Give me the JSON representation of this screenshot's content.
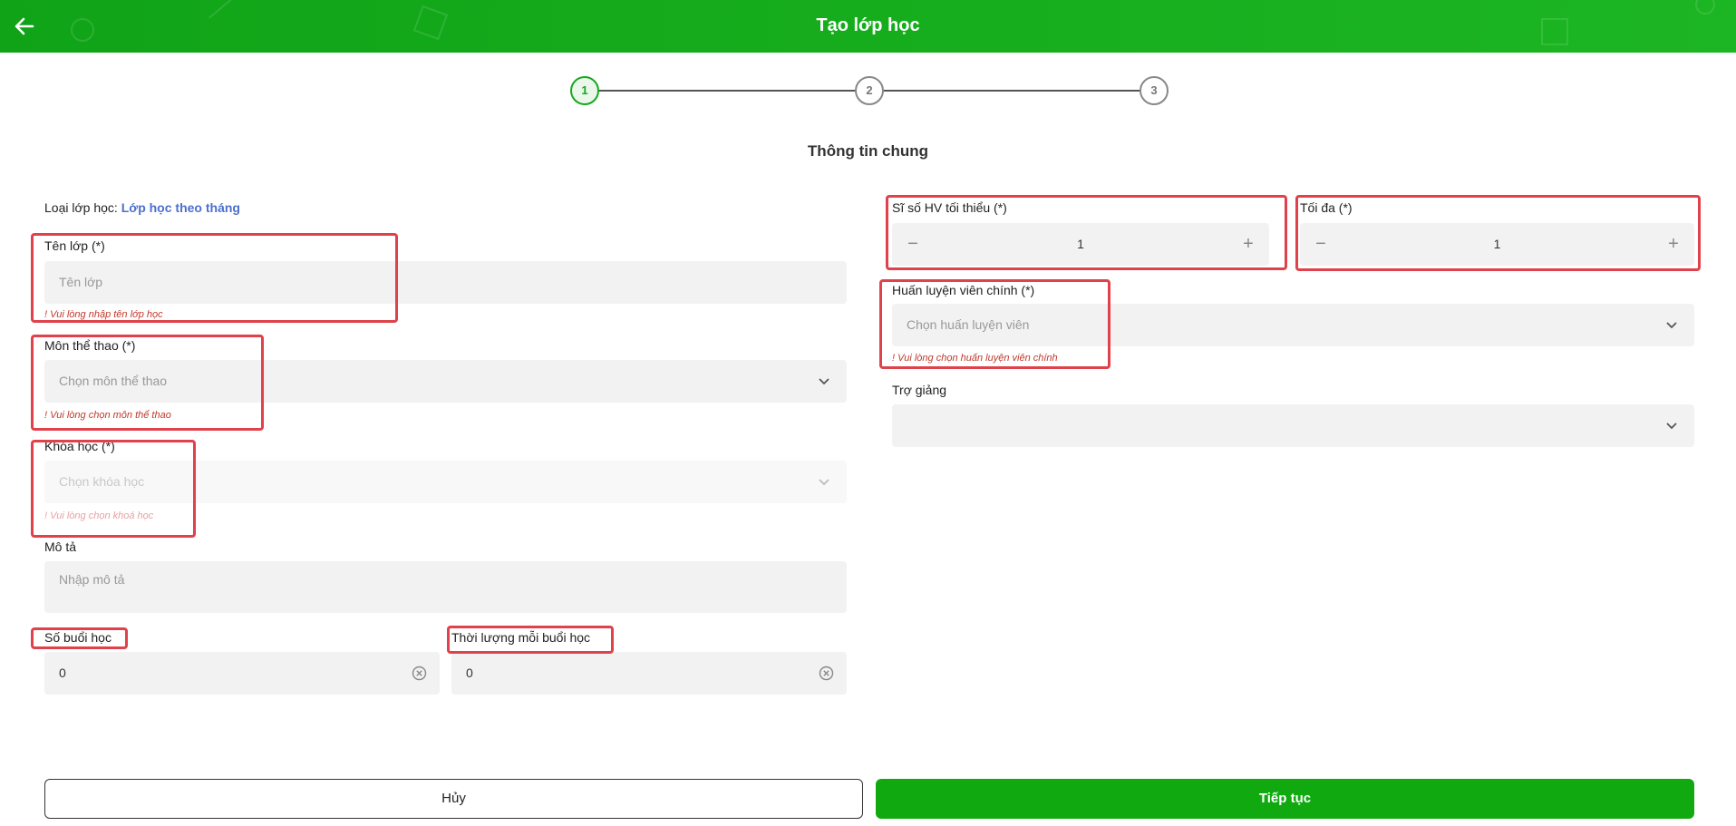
{
  "header": {
    "title": "Tạo lớp học"
  },
  "stepper": {
    "steps": [
      "1",
      "2",
      "3"
    ]
  },
  "section": {
    "title": "Thông tin chung"
  },
  "left": {
    "class_type_label": "Loại lớp học:",
    "class_type_value": "Lớp học theo tháng",
    "name": {
      "label": "Tên lớp (*)",
      "placeholder": "Tên lớp",
      "error": "! Vui lòng nhập tên lớp học"
    },
    "sport": {
      "label": "Môn thể thao (*)",
      "placeholder": "Chọn môn thể thao",
      "error": "! Vui lòng chọn môn thể thao"
    },
    "course": {
      "label": "Khóa học (*)",
      "placeholder": "Chọn khóa học",
      "error": "! Vui lòng chọn khoá học"
    },
    "description": {
      "label": "Mô tả",
      "placeholder": "Nhập mô tả"
    },
    "sessions": {
      "label": "Số buổi học",
      "value": "0"
    },
    "duration": {
      "label": "Thời lượng mỗi buổi học",
      "value": "0"
    }
  },
  "right": {
    "min_students": {
      "label": "Sĩ số HV tối thiểu (*)",
      "value": "1"
    },
    "max_students": {
      "label": "Tối đa (*)",
      "value": "1"
    },
    "head_coach": {
      "label": "Huấn luyện viên chính (*)",
      "placeholder": "Chọn huấn luyện viên",
      "error": "! Vui lòng chọn huấn luyện viên chính"
    },
    "assistant": {
      "label": "Trợ giảng",
      "placeholder": ""
    }
  },
  "buttons": {
    "cancel": "Hủy",
    "next": "Tiếp tục"
  },
  "colors": {
    "header_green": "#16ad1d",
    "primary_button": "#10aa10",
    "accent_link": "#4b6fd0",
    "error_red": "#c0392b",
    "highlight_box": "#e0414b"
  },
  "icons": {
    "back": "arrow-left-icon",
    "dropdown": "chevron-down-icon",
    "clear": "clear-circle-icon",
    "minus": "minus-icon",
    "plus": "plus-icon"
  }
}
